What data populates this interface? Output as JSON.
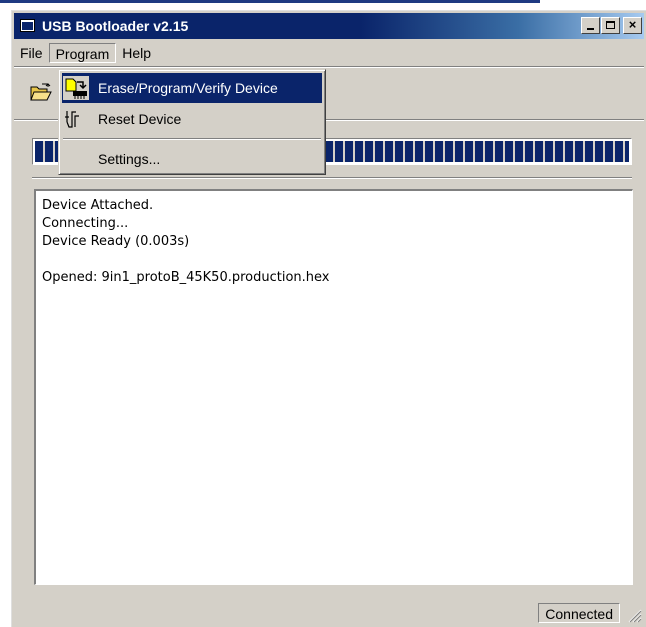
{
  "window": {
    "title": "USB Bootloader v2.15",
    "buttons": {
      "minimize_icon": "minimize-icon",
      "maximize_icon": "maximize-icon",
      "close_glyph": "×"
    }
  },
  "menubar": {
    "items": [
      {
        "label": "File"
      },
      {
        "label": "Program"
      },
      {
        "label": "Help"
      }
    ]
  },
  "toolbar": {
    "open_icon": "folder-open-icon"
  },
  "dropdown": {
    "items": [
      {
        "label": "Erase/Program/Verify Device",
        "icon": "program-device-icon",
        "highlighted": true
      },
      {
        "label": "Reset Device",
        "icon": "reset-device-icon"
      },
      {
        "label": "Settings..."
      }
    ]
  },
  "progress": {
    "value": 1.0
  },
  "log": {
    "lines": [
      "Device Attached.",
      "Connecting...",
      "Device Ready (0.003s)",
      "",
      "Opened: 9in1_protoB_45K50.production.hex"
    ]
  },
  "status": {
    "text": "Connected"
  },
  "colors": {
    "accent": "#0a246a",
    "face": "#d4d0c8"
  }
}
